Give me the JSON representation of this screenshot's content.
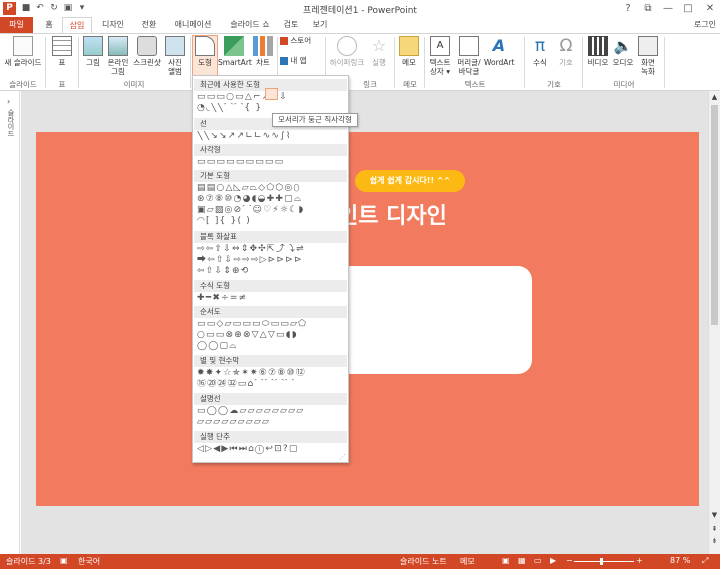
{
  "titlebar": {
    "title": "프레젠테이션1 - PowerPoint",
    "logo": "P"
  },
  "qat": {
    "save_icon": "save-icon",
    "undo_icon": "undo-icon",
    "redo_icon": "redo-icon",
    "start_icon": "slideshow-icon",
    "more_icon": "customize-icon"
  },
  "window": {
    "help": "?",
    "restore": "⧉",
    "minimize": "—",
    "maximize": "□",
    "close": "✕"
  },
  "tabs": [
    {
      "label": "파일"
    },
    {
      "label": "홈"
    },
    {
      "label": "삽입"
    },
    {
      "label": "디자인"
    },
    {
      "label": "전환"
    },
    {
      "label": "애니메이션"
    },
    {
      "label": "슬라이드 쇼"
    },
    {
      "label": "검토"
    },
    {
      "label": "보기"
    }
  ],
  "login": "로그인",
  "ribbon": {
    "new_slide": "새 슬라이드",
    "table": "표",
    "picture": "그림",
    "online_picture": "온라인\n그림",
    "screenshot": "스크린샷",
    "photo_album": "사진\n앨범",
    "shapes": "도형",
    "smartart": "SmartArt",
    "chart": "차트",
    "store": "스토어",
    "my_apps": "내 앱",
    "hyperlink": "하이퍼링크",
    "action": "실행",
    "comment": "메모",
    "textbox": "텍스트\n상자",
    "header_footer": "머리글/\n바닥글",
    "wordart": "WordArt",
    "equation": "수식",
    "symbol": "기호",
    "video": "비디오",
    "audio": "오디오",
    "screen_recording": "화면\n녹화",
    "groups": {
      "slides": "슬라이드",
      "tables": "표",
      "images": "이미지",
      "links": "링크",
      "comments": "메모",
      "text": "텍스트",
      "symbols": "기호",
      "media": "미디어"
    }
  },
  "left_panel": {
    "label": "슬라이드"
  },
  "slide": {
    "pill_text": "쉽게 쉽게 갑시다!! ^^",
    "title_text": "인트 디자인",
    "bg_color": "#f27a5e",
    "accent": "#fdb913"
  },
  "shapes_menu": {
    "sections": [
      {
        "title": "최근에 사용한 도형",
        "rows": [
          "▭▭▭○▭△⌐↗⇨⇩",
          "◔◟╲╲⌒⌒{ }"
        ]
      },
      {
        "title": "선",
        "rows": [
          "╲╲↘↘↗↗∟∟∿∿∫⌇"
        ]
      },
      {
        "title": "사각형",
        "rows": [
          "▭▭▭▭▭▭▭▭▭"
        ]
      },
      {
        "title": "기본 도형",
        "rows": [
          "▤▤○△◺▱⏢◇⬠⬡◎⬯",
          "⊛⑦⑧⑩◔◕◖◒✚✚▢⌓",
          "▣▱▧◎⊘⌒☺♡⚡☼☾◗",
          "◠[ ]{ }( )"
        ]
      },
      {
        "title": "블록 화살표",
        "rows": [
          "⇨⇦⇧⇩⇔⇕✥✣⇱⤴⤵⇌",
          "⮕⇦⇧⇩⇨⇨⇨▷⊳⊳⊳⊳",
          "⇦⇧⇩⇕⊕⟲"
        ]
      },
      {
        "title": "수식 도형",
        "rows": [
          "✚━✖÷=≠"
        ]
      },
      {
        "title": "순서도",
        "rows": [
          "▭▭◇▱▭▭▭⬭▭▭▱⬠",
          "○▭▭⊗⊕⊗▽△▽▭◖◗",
          "◯◯▢⌓"
        ]
      },
      {
        "title": "별 및 현수막",
        "rows": [
          "✹✸✦☆✯✶✷⑥⑦⑧⑩⑫",
          "⑯⑳㉔㉜▭⌂⌒⌒⌒⌒"
        ]
      },
      {
        "title": "설명선",
        "rows": [
          "▭◯◯☁▱▱▱▱▱▱▱▱",
          "▱▱▱▱▱▱▱▱▱"
        ]
      },
      {
        "title": "실행 단추",
        "rows": [
          "◁▷◀▶⏮⏭⌂ⓘ↩⊡?▢"
        ]
      }
    ],
    "tooltip": "모서리가 둥근 직사각형"
  },
  "status": {
    "slide_num": "슬라이드 3/3",
    "language": "한국어",
    "notes": "슬라이드 노트",
    "comments": "메모",
    "zoom": "87 %",
    "zoom_minus": "−",
    "zoom_plus": "+"
  }
}
